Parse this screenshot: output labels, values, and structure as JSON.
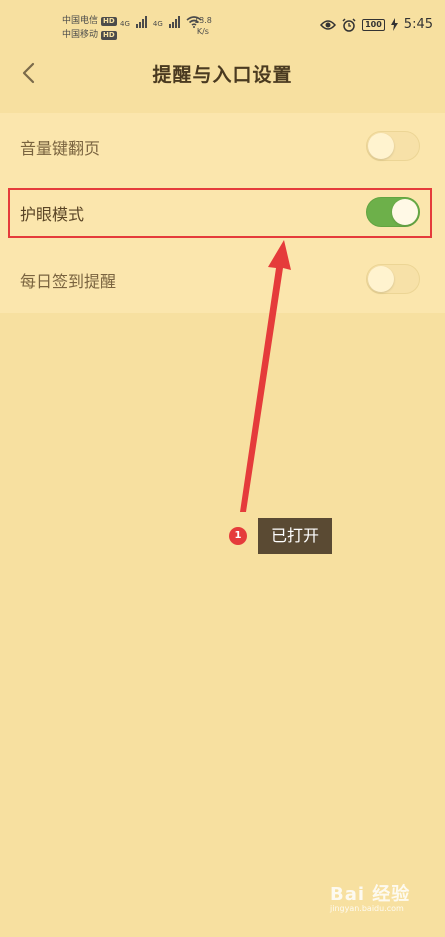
{
  "status_bar": {
    "carrier1": "中国电信",
    "carrier2": "中国移动",
    "hd": "HD",
    "net1": "4G",
    "net2": "4G",
    "speed_value": "13.8",
    "speed_unit": "K/s",
    "battery": "100",
    "time": "5:45"
  },
  "header": {
    "title": "提醒与入口设置",
    "back_icon": "chevron-left-icon"
  },
  "settings": [
    {
      "label": "音量键翻页",
      "enabled": false
    },
    {
      "label": "护眼模式",
      "enabled": true
    },
    {
      "label": "每日签到提醒",
      "enabled": false
    }
  ],
  "annotation": {
    "number": "1",
    "text": "已打开",
    "color": "#e53b3b"
  },
  "watermark": {
    "text": "Bai 经验",
    "sub": "jingyan.baidu.com"
  },
  "colors": {
    "background": "#f7e0a0",
    "toggle_on": "#6db04a",
    "highlight": "#e53b3b"
  }
}
